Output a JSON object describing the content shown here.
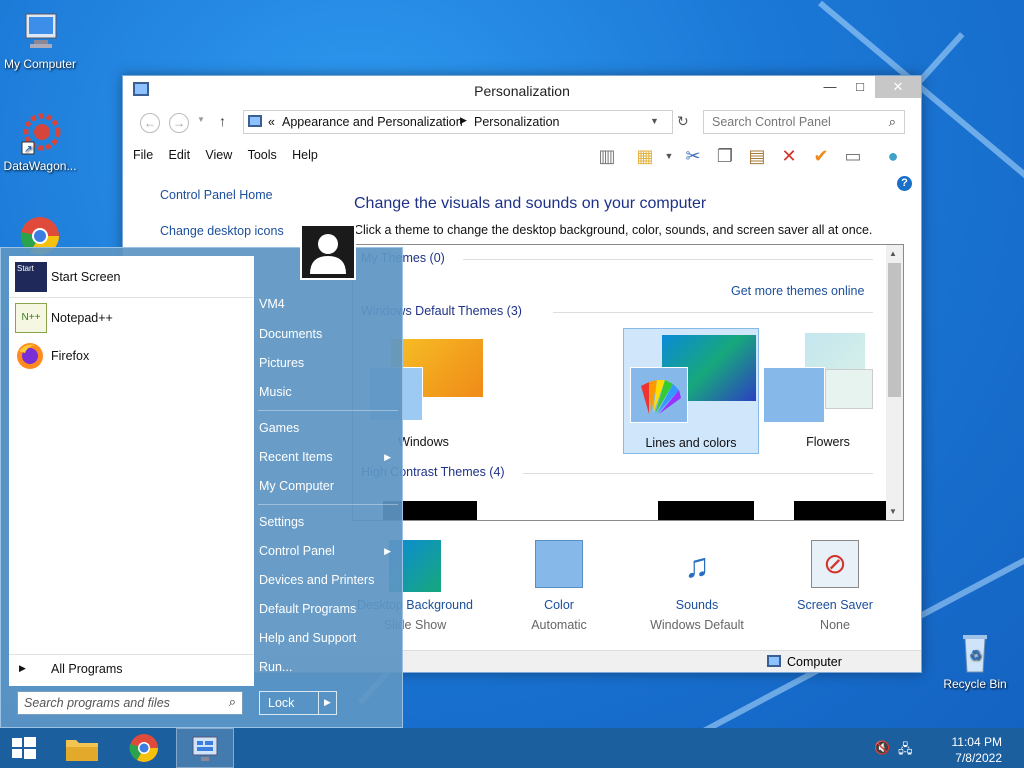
{
  "desktop": {
    "icons": [
      {
        "label": "My Computer",
        "icon": "computer-icon"
      },
      {
        "label": "DataWagon...",
        "icon": "gear-icon"
      },
      {
        "label": "",
        "icon": "chrome-icon"
      },
      {
        "label": "Recycle Bin",
        "icon": "recycle-bin-icon"
      }
    ]
  },
  "window": {
    "title": "Personalization",
    "controls": {
      "minimize": "—",
      "maximize": "□",
      "close": "✕"
    },
    "address": {
      "sep": "«",
      "crumbs": [
        "Appearance and Personalization",
        "Personalization"
      ]
    },
    "search_placeholder": "Search Control Panel",
    "menu": [
      "File",
      "Edit",
      "View",
      "Tools",
      "Help"
    ],
    "left_nav": [
      "Control Panel Home",
      "Change desktop icons"
    ],
    "heading": "Change the visuals and sounds on your computer",
    "subtext": "Click a theme to change the desktop background, color, sounds, and screen saver all at once.",
    "sections": {
      "my_themes": "My Themes (0)",
      "get_more": "Get more themes online",
      "default_themes": "Windows Default Themes (3)",
      "high_contrast": "High Contrast Themes (4)"
    },
    "themes": [
      {
        "name": "Windows",
        "selected": false
      },
      {
        "name": "Lines and colors",
        "selected": true
      },
      {
        "name": "Flowers",
        "selected": false
      }
    ],
    "bottom": [
      {
        "label": "Desktop Background",
        "value": "Slide Show"
      },
      {
        "label": "Color",
        "value": "Automatic"
      },
      {
        "label": "Sounds",
        "value": "Windows Default"
      },
      {
        "label": "Screen Saver",
        "value": "None"
      }
    ],
    "status": "Computer"
  },
  "start_menu": {
    "programs": [
      {
        "label": "Start Screen",
        "icon": "start-screen-icon"
      },
      {
        "label": "Notepad++",
        "icon": "notepad-plus-plus-icon"
      },
      {
        "label": "Firefox",
        "icon": "firefox-icon"
      }
    ],
    "all_programs": "All Programs",
    "search_placeholder": "Search programs and files",
    "right": [
      {
        "label": "VM4",
        "arrow": false
      },
      {
        "label": "Documents",
        "arrow": false
      },
      {
        "label": "Pictures",
        "arrow": false
      },
      {
        "label": "Music",
        "arrow": false
      },
      {
        "label": "Games",
        "arrow": false
      },
      {
        "label": "Recent Items",
        "arrow": true
      },
      {
        "label": "My Computer",
        "arrow": false
      },
      {
        "label": "Settings",
        "arrow": false
      },
      {
        "label": "Control Panel",
        "arrow": true
      },
      {
        "label": "Devices and Printers",
        "arrow": false
      },
      {
        "label": "Default Programs",
        "arrow": false
      },
      {
        "label": "Help and Support",
        "arrow": false
      },
      {
        "label": "Run...",
        "arrow": false
      }
    ],
    "lock": "Lock"
  },
  "taskbar": {
    "time": "11:04 PM",
    "date": "7/8/2022"
  },
  "colors": {
    "link": "#1b4f9c",
    "heading": "#1e3287",
    "taskbar": "#1c5f9e"
  }
}
